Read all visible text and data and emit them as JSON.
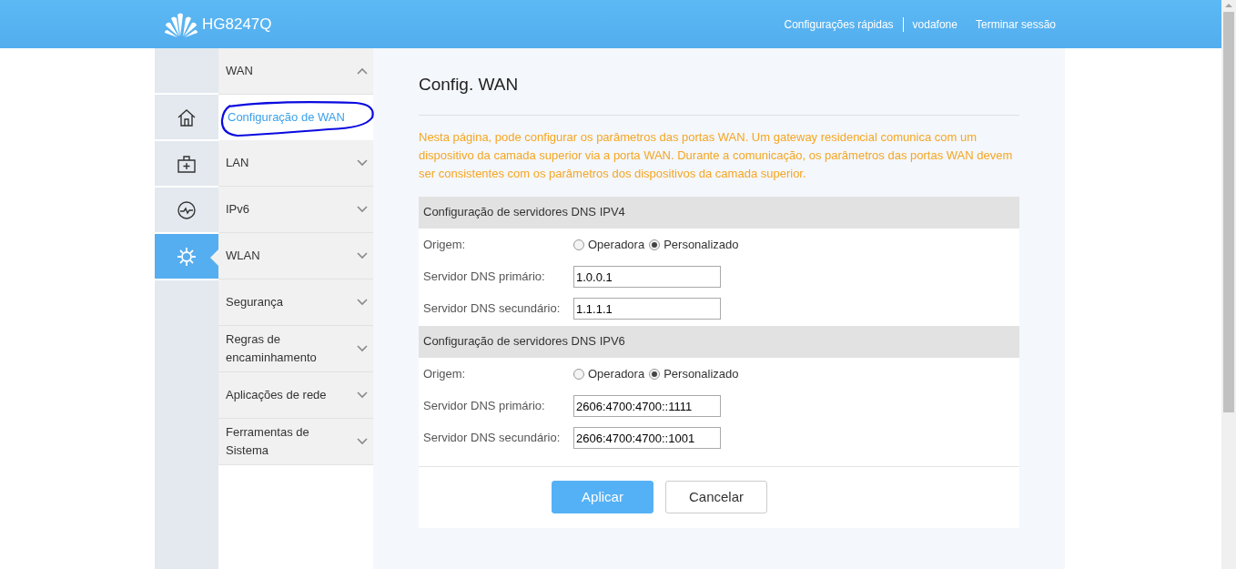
{
  "header": {
    "logo_text": "HG8247Q",
    "links": [
      "Configurações rápidas",
      "vodafone",
      "Terminar sessão"
    ]
  },
  "rail": [
    {
      "kind": "home",
      "selected": false
    },
    {
      "kind": "kit",
      "selected": false
    },
    {
      "kind": "pulse",
      "selected": false
    },
    {
      "kind": "gear",
      "selected": true
    }
  ],
  "menu": [
    {
      "label": "WAN",
      "expanded": true,
      "children": [
        {
          "label": "Configuração de WAN",
          "selected": true,
          "annotated": true
        }
      ]
    },
    {
      "label": "LAN",
      "expanded": false
    },
    {
      "label": "IPv6",
      "expanded": false
    },
    {
      "label": "WLAN",
      "expanded": false
    },
    {
      "label": "Segurança",
      "expanded": false
    },
    {
      "label": "Regras de encaminhamento",
      "expanded": false
    },
    {
      "label": "Aplicações de rede",
      "expanded": false
    },
    {
      "label": "Ferramentas de Sistema",
      "expanded": false
    }
  ],
  "page": {
    "title": "Config. WAN",
    "description": "Nesta página, pode configurar os parâmetros das portas WAN. Um gateway residencial comunica com um dispositivo da camada superior via a porta WAN. Durante a comunicação, os parâmetros das portas WAN devem ser consistentes com os parâmetros dos dispositivos da camada superior.",
    "sections": [
      {
        "title": "Configuração de servidores DNS IPV4",
        "fields": [
          {
            "kind": "radio",
            "label": "Origem:",
            "options": [
              {
                "label": "Operadora",
                "selected": false
              },
              {
                "label": "Personalizado",
                "selected": true
              }
            ]
          },
          {
            "kind": "text",
            "label": "Servidor DNS primário:",
            "value": "1.0.0.1"
          },
          {
            "kind": "text",
            "label": "Servidor DNS secundário:",
            "value": "1.1.1.1"
          }
        ]
      },
      {
        "title": "Configuração de servidores DNS IPV6",
        "fields": [
          {
            "kind": "radio",
            "label": "Origem:",
            "options": [
              {
                "label": "Operadora",
                "selected": false
              },
              {
                "label": "Personalizado",
                "selected": true
              }
            ]
          },
          {
            "kind": "text",
            "label": "Servidor DNS primário:",
            "value": "2606:4700:4700::1111"
          },
          {
            "kind": "text",
            "label": "Servidor DNS secundário:",
            "value": "2606:4700:4700::1001"
          }
        ]
      }
    ],
    "buttons": [
      {
        "label": "Aplicar",
        "kind": "primary"
      },
      {
        "label": "Cancelar",
        "kind": "secondary"
      }
    ]
  }
}
